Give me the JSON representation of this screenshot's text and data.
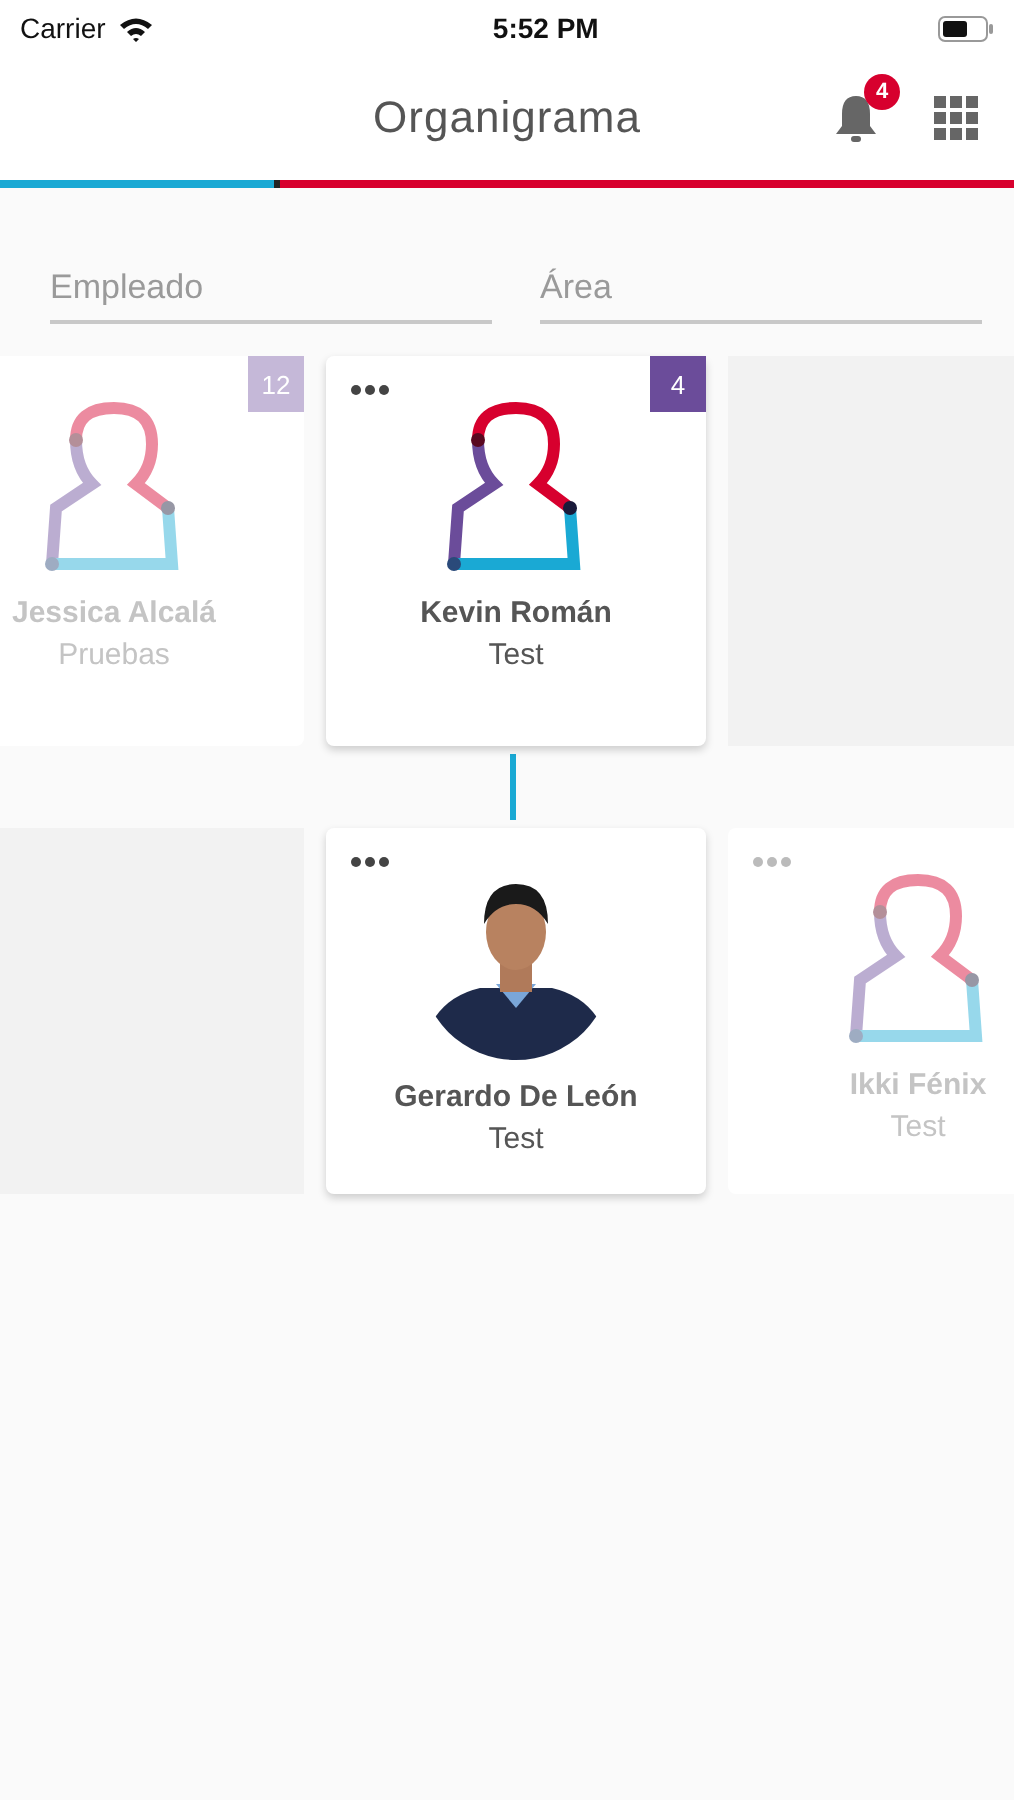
{
  "status_bar": {
    "carrier": "Carrier",
    "time": "5:52 PM"
  },
  "header": {
    "title": "Organigrama",
    "notification_count": "4"
  },
  "progress": {
    "level": 0.27
  },
  "filters": [
    {
      "placeholder": "Empleado"
    },
    {
      "placeholder": "Área"
    }
  ],
  "rows": [
    {
      "items": [
        {
          "kind": "person",
          "name": "Jessica Alcalá",
          "area": "Pruebas",
          "active": false,
          "has_photo": false,
          "count": "12",
          "menu": false
        },
        {
          "kind": "person",
          "name": "Kevin Román",
          "area": "Test",
          "active": true,
          "has_photo": false,
          "count": "4",
          "menu": true
        },
        {
          "kind": "empty"
        }
      ]
    },
    {
      "items": [
        {
          "kind": "empty"
        },
        {
          "kind": "person",
          "name": "Gerardo De León",
          "area": "Test",
          "active": true,
          "has_photo": true,
          "menu": true
        },
        {
          "kind": "person",
          "name": "Ikki Fénix",
          "area": "Test",
          "active": false,
          "has_photo": false,
          "menu": true
        }
      ]
    }
  ]
}
